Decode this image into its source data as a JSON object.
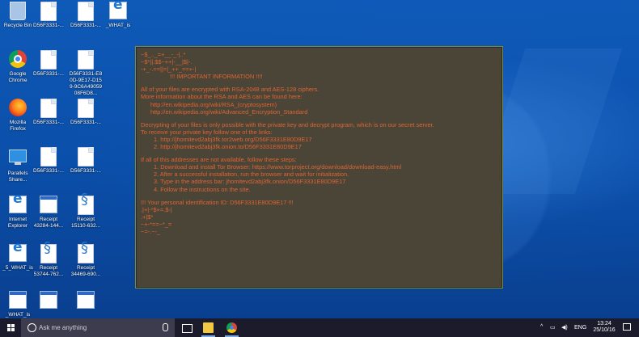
{
  "desktop": {
    "icons": [
      {
        "label": "Recycle Bin",
        "kind": "bin"
      },
      {
        "label": "D56F3331-...",
        "kind": "doc"
      },
      {
        "label": "D56F3331-...",
        "kind": "doc"
      },
      {
        "label": "_WHAT_is",
        "kind": "ie"
      },
      {
        "label": "Google\nChrome",
        "kind": "chrome"
      },
      {
        "label": "D56F3331-...",
        "kind": "doc"
      },
      {
        "label": "D56F3331-E8\n0D-9E17-D15\n9-9C6A49059\n08F6D8...",
        "kind": "doc"
      },
      {
        "label": "Mozilla\nFirefox",
        "kind": "firefox"
      },
      {
        "label": "D56F3331-...",
        "kind": "doc"
      },
      {
        "label": "D56F3331-...",
        "kind": "doc"
      },
      {
        "label": "Parallels\nShare...",
        "kind": "pc"
      },
      {
        "label": "D56F3331-...",
        "kind": "doc"
      },
      {
        "label": "D56F3331-...",
        "kind": "doc"
      },
      {
        "label": "Internet\nExplorer",
        "kind": "ie"
      },
      {
        "label": "Receipt\n43284-144...",
        "kind": "win"
      },
      {
        "label": "Receipt\n15110-632...",
        "kind": "receipt"
      },
      {
        "label": "_5_WHAT_is",
        "kind": "ie"
      },
      {
        "label": "Receipt\n53744-762...",
        "kind": "receipt"
      },
      {
        "label": "Receipt\n34469-690...",
        "kind": "receipt"
      },
      {
        "label": "_WHAT_is",
        "kind": "win"
      },
      {
        "label": "",
        "kind": "win"
      },
      {
        "label": "",
        "kind": "win"
      }
    ]
  },
  "note": {
    "art1": "~$_.._=+__-_-|..*",
    "art2": "~$*||.$$~++|-__|$|-.",
    "art3": "-+_-.==||=|_++_==+-|",
    "important": "!!! IMPORTANT INFORMATION !!!!",
    "p1a": "All of your files are encrypted with RSA-2048 and AES-128 ciphers.",
    "p1b": "More information about the RSA and AES can be found here:",
    "link1": "http://en.wikipedia.org/wiki/RSA_(cryptosystem)",
    "link2": "http://en.wikipedia.org/wiki/Advanced_Encryption_Standard",
    "p2a": "Decrypting of your files is only possible with the private key and decrypt program, which is on our secret server.",
    "p2b": "To receive your private key follow one of the links:",
    "l1": "1. http://jhomitevd2abj3fk.tor2web.org/D56F3331E80D9E17",
    "l2": "2. http://jhomitevd2abj3fk.onion.to/D56F3331E80D9E17",
    "p3": "If all of this addresses are not available, follow these steps:",
    "s1": "1. Download and install Tor Browser: https://www.torproject.org/download/download-easy.html",
    "s2": "2. After a successful installation, run the browser and wait for initialization.",
    "s3": "3. Type in the address bar: jhomitevd2abj3fk.onion/D56F3331E80D9E17",
    "s4": "4. Follow the instructions on the site.",
    "idline": "!!! Your personal identification ID: D56F3331E80D9E17 !!!",
    "art4": ".|+|-*$+=.$-|",
    "art5": ".+|$*",
    "art6": "~+-*==~*_=",
    "art7": "~=-.~-_"
  },
  "taskbar": {
    "search_placeholder": "Ask me anything",
    "lang": "ENG",
    "time": "13:24",
    "date": "25/10/16"
  }
}
